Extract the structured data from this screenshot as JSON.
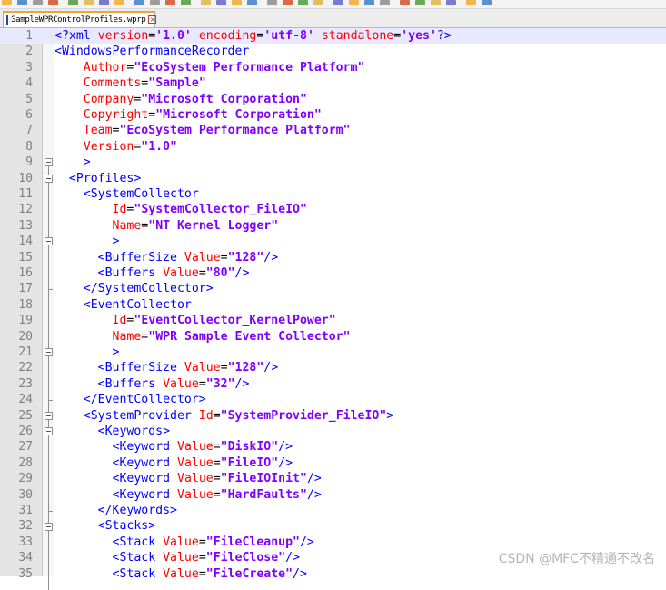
{
  "toolbar": {
    "icon_count": 30
  },
  "tab": {
    "label": "SampleWPRControlProfiles.wprp",
    "close_label": "×"
  },
  "editor": {
    "lines": [
      {
        "n": "1",
        "tokens": [
          [
            "tag",
            "<?xml "
          ],
          [
            "attr",
            "version"
          ],
          [
            "plain",
            "="
          ],
          [
            "val",
            "'1.0'"
          ],
          [
            "plain",
            " "
          ],
          [
            "attr",
            "encoding"
          ],
          [
            "plain",
            "="
          ],
          [
            "val",
            "'utf-8'"
          ],
          [
            "plain",
            " "
          ],
          [
            "attr",
            "standalone"
          ],
          [
            "plain",
            "="
          ],
          [
            "val",
            "'yes'"
          ],
          [
            "tag",
            "?>"
          ]
        ]
      },
      {
        "n": "2",
        "tokens": [
          [
            "tag",
            "<WindowsPerformanceRecorder"
          ]
        ]
      },
      {
        "n": "3",
        "tokens": [
          [
            "plain",
            "    "
          ],
          [
            "attr",
            "Author"
          ],
          [
            "plain",
            "="
          ],
          [
            "val",
            "\"EcoSystem Performance Platform\""
          ]
        ]
      },
      {
        "n": "4",
        "tokens": [
          [
            "plain",
            "    "
          ],
          [
            "attr",
            "Comments"
          ],
          [
            "plain",
            "="
          ],
          [
            "val",
            "\"Sample\""
          ]
        ]
      },
      {
        "n": "5",
        "tokens": [
          [
            "plain",
            "    "
          ],
          [
            "attr",
            "Company"
          ],
          [
            "plain",
            "="
          ],
          [
            "val",
            "\"Microsoft Corporation\""
          ]
        ]
      },
      {
        "n": "6",
        "tokens": [
          [
            "plain",
            "    "
          ],
          [
            "attr",
            "Copyright"
          ],
          [
            "plain",
            "="
          ],
          [
            "val",
            "\"Microsoft Corporation\""
          ]
        ]
      },
      {
        "n": "7",
        "tokens": [
          [
            "plain",
            "    "
          ],
          [
            "attr",
            "Team"
          ],
          [
            "plain",
            "="
          ],
          [
            "val",
            "\"EcoSystem Performance Platform\""
          ]
        ]
      },
      {
        "n": "8",
        "tokens": [
          [
            "plain",
            "    "
          ],
          [
            "attr",
            "Version"
          ],
          [
            "plain",
            "="
          ],
          [
            "val",
            "\"1.0\""
          ]
        ]
      },
      {
        "n": "9",
        "tokens": [
          [
            "plain",
            "    "
          ],
          [
            "tag",
            ">"
          ]
        ]
      },
      {
        "n": "10",
        "tokens": [
          [
            "plain",
            "  "
          ],
          [
            "tag",
            "<Profiles>"
          ]
        ]
      },
      {
        "n": "11",
        "tokens": [
          [
            "plain",
            "    "
          ],
          [
            "tag",
            "<SystemCollector"
          ]
        ]
      },
      {
        "n": "12",
        "tokens": [
          [
            "plain",
            "        "
          ],
          [
            "attr",
            "Id"
          ],
          [
            "plain",
            "="
          ],
          [
            "val",
            "\"SystemCollector_FileIO\""
          ]
        ]
      },
      {
        "n": "13",
        "tokens": [
          [
            "plain",
            "        "
          ],
          [
            "attr",
            "Name"
          ],
          [
            "plain",
            "="
          ],
          [
            "val",
            "\"NT Kernel Logger\""
          ]
        ]
      },
      {
        "n": "14",
        "tokens": [
          [
            "plain",
            "        "
          ],
          [
            "tag",
            ">"
          ]
        ]
      },
      {
        "n": "15",
        "tokens": [
          [
            "plain",
            "      "
          ],
          [
            "tag",
            "<BufferSize "
          ],
          [
            "attr",
            "Value"
          ],
          [
            "plain",
            "="
          ],
          [
            "val",
            "\"128\""
          ],
          [
            "tag",
            "/>"
          ]
        ]
      },
      {
        "n": "16",
        "tokens": [
          [
            "plain",
            "      "
          ],
          [
            "tag",
            "<Buffers "
          ],
          [
            "attr",
            "Value"
          ],
          [
            "plain",
            "="
          ],
          [
            "val",
            "\"80\""
          ],
          [
            "tag",
            "/>"
          ]
        ]
      },
      {
        "n": "17",
        "tokens": [
          [
            "plain",
            "    "
          ],
          [
            "tag",
            "</SystemCollector>"
          ]
        ]
      },
      {
        "n": "18",
        "tokens": [
          [
            "plain",
            "    "
          ],
          [
            "tag",
            "<EventCollector"
          ]
        ]
      },
      {
        "n": "19",
        "tokens": [
          [
            "plain",
            "        "
          ],
          [
            "attr",
            "Id"
          ],
          [
            "plain",
            "="
          ],
          [
            "val",
            "\"EventCollector_KernelPower\""
          ]
        ]
      },
      {
        "n": "20",
        "tokens": [
          [
            "plain",
            "        "
          ],
          [
            "attr",
            "Name"
          ],
          [
            "plain",
            "="
          ],
          [
            "val",
            "\"WPR Sample Event Collector\""
          ]
        ]
      },
      {
        "n": "21",
        "tokens": [
          [
            "plain",
            "        "
          ],
          [
            "tag",
            ">"
          ]
        ]
      },
      {
        "n": "22",
        "tokens": [
          [
            "plain",
            "      "
          ],
          [
            "tag",
            "<BufferSize "
          ],
          [
            "attr",
            "Value"
          ],
          [
            "plain",
            "="
          ],
          [
            "val",
            "\"128\""
          ],
          [
            "tag",
            "/>"
          ]
        ]
      },
      {
        "n": "23",
        "tokens": [
          [
            "plain",
            "      "
          ],
          [
            "tag",
            "<Buffers "
          ],
          [
            "attr",
            "Value"
          ],
          [
            "plain",
            "="
          ],
          [
            "val",
            "\"32\""
          ],
          [
            "tag",
            "/>"
          ]
        ]
      },
      {
        "n": "24",
        "tokens": [
          [
            "plain",
            "    "
          ],
          [
            "tag",
            "</EventCollector>"
          ]
        ]
      },
      {
        "n": "25",
        "tokens": [
          [
            "plain",
            "    "
          ],
          [
            "tag",
            "<SystemProvider "
          ],
          [
            "attr",
            "Id"
          ],
          [
            "plain",
            "="
          ],
          [
            "val",
            "\"SystemProvider_FileIO\""
          ],
          [
            "tag",
            ">"
          ]
        ]
      },
      {
        "n": "26",
        "tokens": [
          [
            "plain",
            "      "
          ],
          [
            "tag",
            "<Keywords>"
          ]
        ]
      },
      {
        "n": "27",
        "tokens": [
          [
            "plain",
            "        "
          ],
          [
            "tag",
            "<Keyword "
          ],
          [
            "attr",
            "Value"
          ],
          [
            "plain",
            "="
          ],
          [
            "val",
            "\"DiskIO\""
          ],
          [
            "tag",
            "/>"
          ]
        ]
      },
      {
        "n": "28",
        "tokens": [
          [
            "plain",
            "        "
          ],
          [
            "tag",
            "<Keyword "
          ],
          [
            "attr",
            "Value"
          ],
          [
            "plain",
            "="
          ],
          [
            "val",
            "\"FileIO\""
          ],
          [
            "tag",
            "/>"
          ]
        ]
      },
      {
        "n": "29",
        "tokens": [
          [
            "plain",
            "        "
          ],
          [
            "tag",
            "<Keyword "
          ],
          [
            "attr",
            "Value"
          ],
          [
            "plain",
            "="
          ],
          [
            "val",
            "\"FileIOInit\""
          ],
          [
            "tag",
            "/>"
          ]
        ]
      },
      {
        "n": "30",
        "tokens": [
          [
            "plain",
            "        "
          ],
          [
            "tag",
            "<Keyword "
          ],
          [
            "attr",
            "Value"
          ],
          [
            "plain",
            "="
          ],
          [
            "val",
            "\"HardFaults\""
          ],
          [
            "tag",
            "/>"
          ]
        ]
      },
      {
        "n": "31",
        "tokens": [
          [
            "plain",
            "      "
          ],
          [
            "tag",
            "</Keywords>"
          ]
        ]
      },
      {
        "n": "32",
        "tokens": [
          [
            "plain",
            "      "
          ],
          [
            "tag",
            "<Stacks>"
          ]
        ]
      },
      {
        "n": "33",
        "tokens": [
          [
            "plain",
            "        "
          ],
          [
            "tag",
            "<Stack "
          ],
          [
            "attr",
            "Value"
          ],
          [
            "plain",
            "="
          ],
          [
            "val",
            "\"FileCleanup\""
          ],
          [
            "tag",
            "/>"
          ]
        ]
      },
      {
        "n": "34",
        "tokens": [
          [
            "plain",
            "        "
          ],
          [
            "tag",
            "<Stack "
          ],
          [
            "attr",
            "Value"
          ],
          [
            "plain",
            "="
          ],
          [
            "val",
            "\"FileClose\""
          ],
          [
            "tag",
            "/>"
          ]
        ]
      },
      {
        "n": "35",
        "tokens": [
          [
            "plain",
            "        "
          ],
          [
            "tag",
            "<Stack "
          ],
          [
            "attr",
            "Value"
          ],
          [
            "plain",
            "="
          ],
          [
            "val",
            "\"FileCreate\""
          ],
          [
            "tag",
            "/>"
          ]
        ]
      }
    ]
  },
  "watermark": {
    "text": "CSDN @MFC不精通不改名"
  },
  "colors": {
    "tag": "#0000ff",
    "attr": "#ff0000",
    "value": "#8000ff",
    "gutter": "#e4e4e4",
    "current_line": "#e8e8ff"
  }
}
